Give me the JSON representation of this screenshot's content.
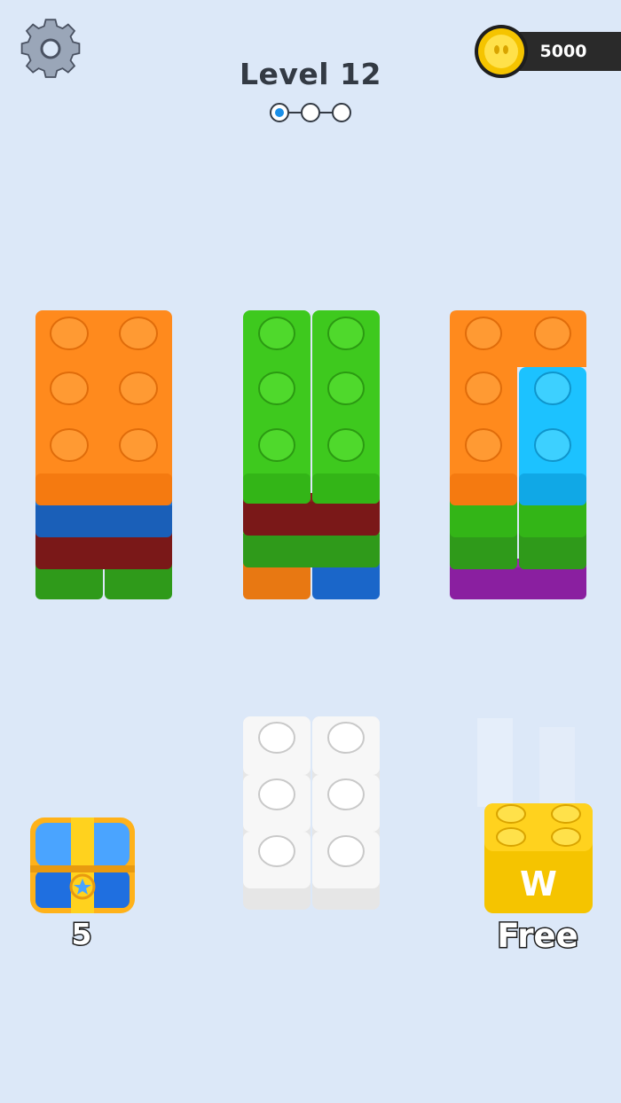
{
  "header": {
    "level_title": "Level 12",
    "stage_progress": {
      "total": 3,
      "current": 1
    },
    "coins": "5000"
  },
  "icons": {
    "settings": "gear-icon",
    "coin": "coin-icon",
    "chest": "treasure-chest-icon"
  },
  "boards": [
    {
      "id": "left",
      "layers_top_to_bottom": [
        "orange 2x3",
        "blue",
        "dark-red",
        "green"
      ]
    },
    {
      "id": "middle",
      "layers_top_to_bottom": [
        "green 1x3",
        "green 1x3",
        "dark-red",
        "green",
        "orange",
        "blue"
      ]
    },
    {
      "id": "right",
      "layers_top_to_bottom": [
        "orange L",
        "cyan 1x2",
        "green",
        "green",
        "purple"
      ]
    }
  ],
  "tray": {
    "piece": "white 2x3"
  },
  "chest": {
    "count": "5"
  },
  "booster": {
    "letter": "W",
    "label": "Free",
    "color": "#ffd21e"
  },
  "colors": {
    "background": "#dce8f8",
    "orange": "#ff8a1d",
    "green": "#3ec91e",
    "blue": "#1f77d9",
    "dark_red": "#8a1c1c",
    "cyan": "#1cc2ff",
    "purple": "#9c27b0",
    "white_piece": "#f2f2f2",
    "progress_active": "#1a8fe8"
  }
}
